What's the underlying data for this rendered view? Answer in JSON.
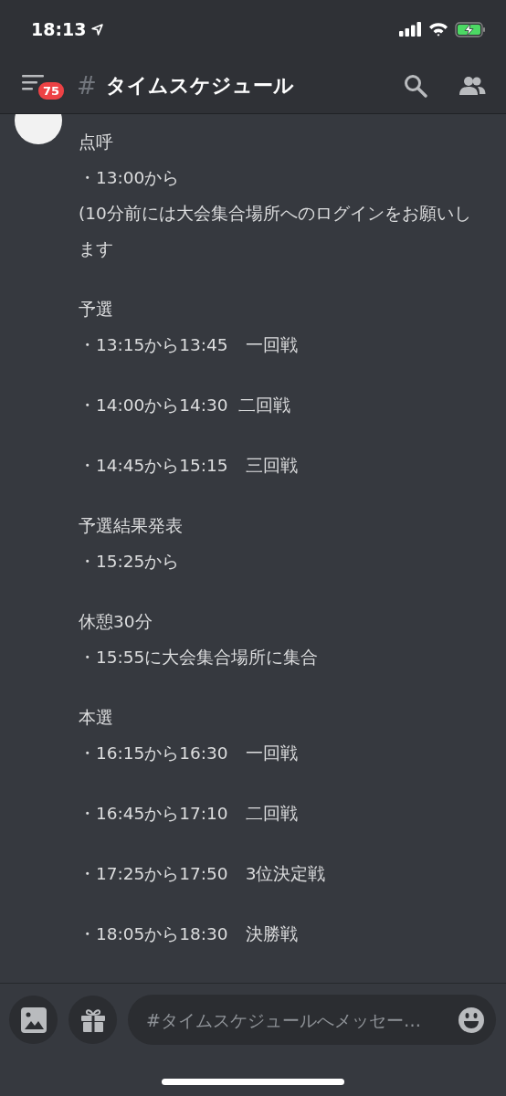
{
  "status_bar": {
    "time": "18:13"
  },
  "header": {
    "badge": "75",
    "hash": "#",
    "title": "タイムスケジュール"
  },
  "message": {
    "paragraphs": [
      [
        "点呼",
        "・13:00から",
        "(10分前には大会集合場所へのログインをお願いします"
      ],
      [
        "予選",
        "・13:15から13:45　一回戦"
      ],
      [
        "・14:00から14:30  二回戦"
      ],
      [
        "・14:45から15:15　三回戦"
      ],
      [
        "予選結果発表",
        "・15:25から"
      ],
      [
        "休憩30分",
        "・15:55に大会集合場所に集合"
      ],
      [
        "本選",
        "・16:15から16:30　一回戦"
      ],
      [
        "・16:45から17:10　二回戦"
      ],
      [
        "・17:25から17:50　3位決定戦"
      ],
      [
        "・18:05から18:30　決勝戦"
      ]
    ]
  },
  "composer": {
    "placeholder": "#タイムスケジュールへメッセー…"
  }
}
